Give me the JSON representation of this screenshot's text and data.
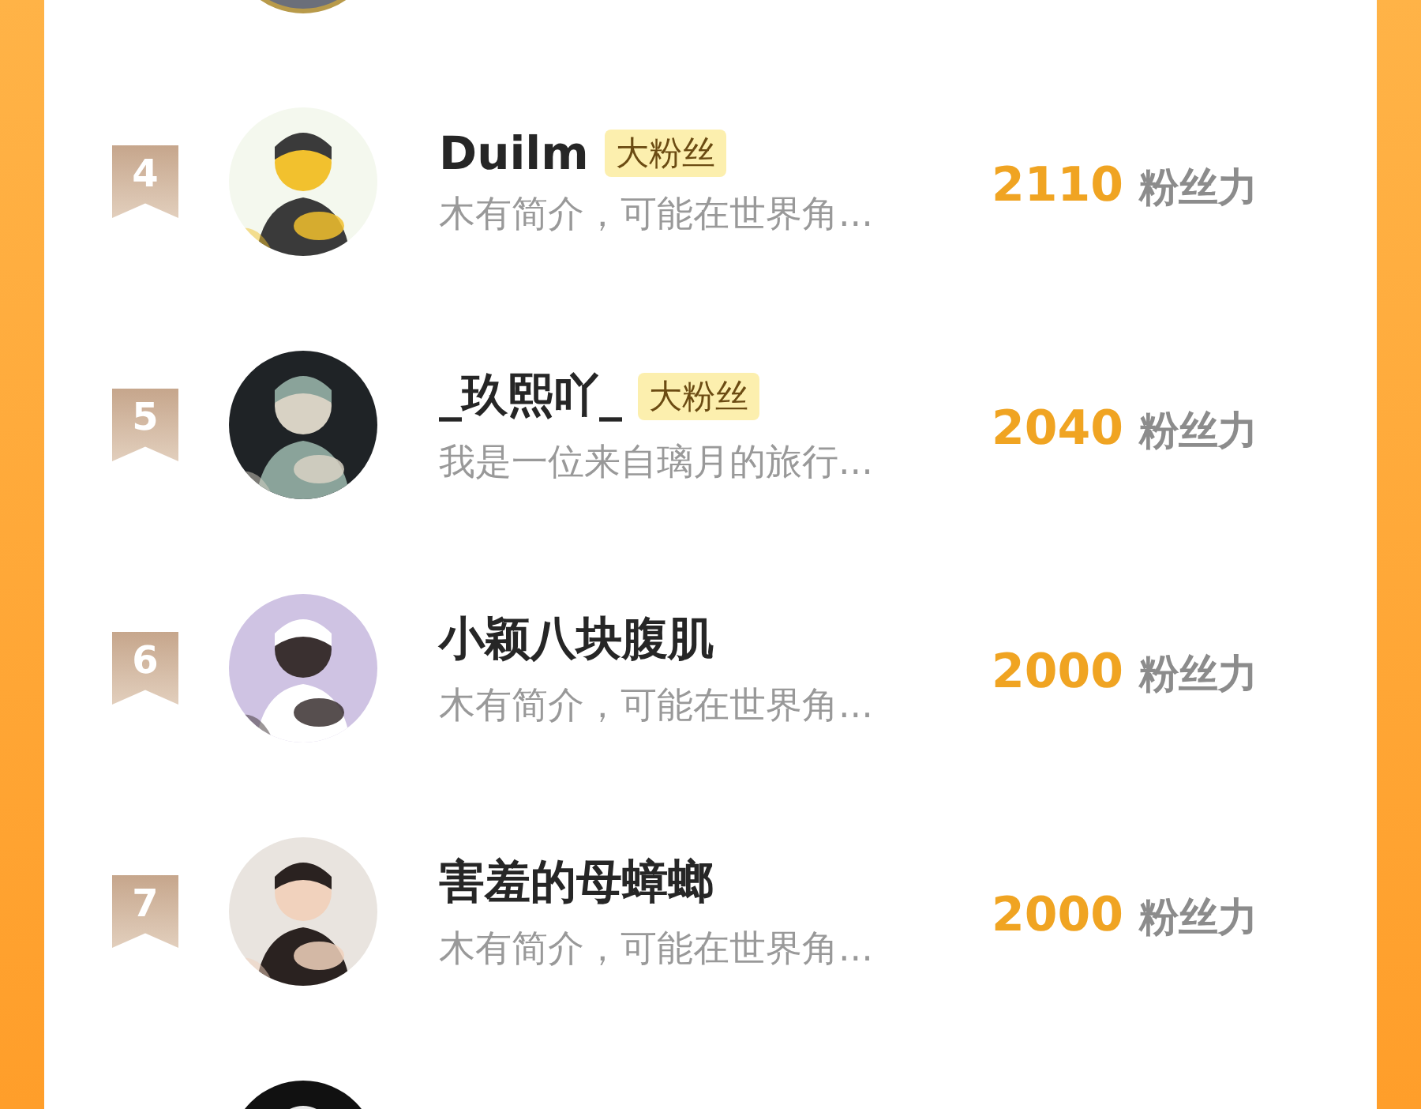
{
  "rows": [
    {
      "kind": "cut"
    },
    {
      "kind": "entry",
      "rank": "4",
      "name": "Duilm",
      "tag": "大粉丝",
      "bio": "木有简介，可能在世界角...",
      "score": "2110",
      "unit": "粉丝力"
    },
    {
      "kind": "entry",
      "rank": "5",
      "name": "_玖熙吖_",
      "tag": "大粉丝",
      "bio": "我是一位来自璃月的旅行...",
      "score": "2040",
      "unit": "粉丝力"
    },
    {
      "kind": "entry",
      "rank": "6",
      "name": "小颖八块腹肌",
      "bio": "木有简介，可能在世界角...",
      "score": "2000",
      "unit": "粉丝力"
    },
    {
      "kind": "entry",
      "rank": "7",
      "name": "害羞的母蟑螂",
      "bio": "木有简介，可能在世界角...",
      "score": "2000",
      "unit": "粉丝力"
    },
    {
      "kind": "cut"
    }
  ]
}
